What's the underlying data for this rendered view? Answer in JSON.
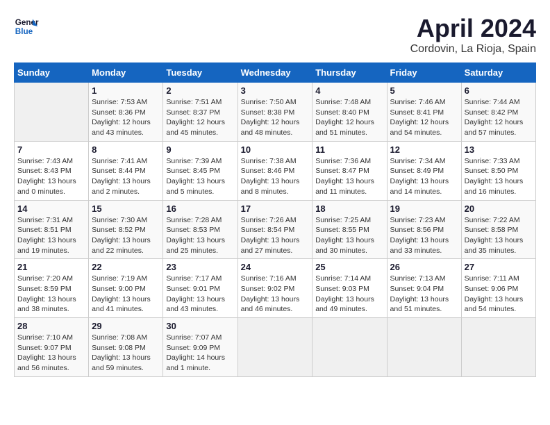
{
  "header": {
    "logo_line1": "General",
    "logo_line2": "Blue",
    "month": "April 2024",
    "location": "Cordovin, La Rioja, Spain"
  },
  "weekdays": [
    "Sunday",
    "Monday",
    "Tuesday",
    "Wednesday",
    "Thursday",
    "Friday",
    "Saturday"
  ],
  "weeks": [
    [
      {
        "day": "",
        "info": ""
      },
      {
        "day": "1",
        "info": "Sunrise: 7:53 AM\nSunset: 8:36 PM\nDaylight: 12 hours\nand 43 minutes."
      },
      {
        "day": "2",
        "info": "Sunrise: 7:51 AM\nSunset: 8:37 PM\nDaylight: 12 hours\nand 45 minutes."
      },
      {
        "day": "3",
        "info": "Sunrise: 7:50 AM\nSunset: 8:38 PM\nDaylight: 12 hours\nand 48 minutes."
      },
      {
        "day": "4",
        "info": "Sunrise: 7:48 AM\nSunset: 8:40 PM\nDaylight: 12 hours\nand 51 minutes."
      },
      {
        "day": "5",
        "info": "Sunrise: 7:46 AM\nSunset: 8:41 PM\nDaylight: 12 hours\nand 54 minutes."
      },
      {
        "day": "6",
        "info": "Sunrise: 7:44 AM\nSunset: 8:42 PM\nDaylight: 12 hours\nand 57 minutes."
      }
    ],
    [
      {
        "day": "7",
        "info": "Sunrise: 7:43 AM\nSunset: 8:43 PM\nDaylight: 13 hours\nand 0 minutes."
      },
      {
        "day": "8",
        "info": "Sunrise: 7:41 AM\nSunset: 8:44 PM\nDaylight: 13 hours\nand 2 minutes."
      },
      {
        "day": "9",
        "info": "Sunrise: 7:39 AM\nSunset: 8:45 PM\nDaylight: 13 hours\nand 5 minutes."
      },
      {
        "day": "10",
        "info": "Sunrise: 7:38 AM\nSunset: 8:46 PM\nDaylight: 13 hours\nand 8 minutes."
      },
      {
        "day": "11",
        "info": "Sunrise: 7:36 AM\nSunset: 8:47 PM\nDaylight: 13 hours\nand 11 minutes."
      },
      {
        "day": "12",
        "info": "Sunrise: 7:34 AM\nSunset: 8:49 PM\nDaylight: 13 hours\nand 14 minutes."
      },
      {
        "day": "13",
        "info": "Sunrise: 7:33 AM\nSunset: 8:50 PM\nDaylight: 13 hours\nand 16 minutes."
      }
    ],
    [
      {
        "day": "14",
        "info": "Sunrise: 7:31 AM\nSunset: 8:51 PM\nDaylight: 13 hours\nand 19 minutes."
      },
      {
        "day": "15",
        "info": "Sunrise: 7:30 AM\nSunset: 8:52 PM\nDaylight: 13 hours\nand 22 minutes."
      },
      {
        "day": "16",
        "info": "Sunrise: 7:28 AM\nSunset: 8:53 PM\nDaylight: 13 hours\nand 25 minutes."
      },
      {
        "day": "17",
        "info": "Sunrise: 7:26 AM\nSunset: 8:54 PM\nDaylight: 13 hours\nand 27 minutes."
      },
      {
        "day": "18",
        "info": "Sunrise: 7:25 AM\nSunset: 8:55 PM\nDaylight: 13 hours\nand 30 minutes."
      },
      {
        "day": "19",
        "info": "Sunrise: 7:23 AM\nSunset: 8:56 PM\nDaylight: 13 hours\nand 33 minutes."
      },
      {
        "day": "20",
        "info": "Sunrise: 7:22 AM\nSunset: 8:58 PM\nDaylight: 13 hours\nand 35 minutes."
      }
    ],
    [
      {
        "day": "21",
        "info": "Sunrise: 7:20 AM\nSunset: 8:59 PM\nDaylight: 13 hours\nand 38 minutes."
      },
      {
        "day": "22",
        "info": "Sunrise: 7:19 AM\nSunset: 9:00 PM\nDaylight: 13 hours\nand 41 minutes."
      },
      {
        "day": "23",
        "info": "Sunrise: 7:17 AM\nSunset: 9:01 PM\nDaylight: 13 hours\nand 43 minutes."
      },
      {
        "day": "24",
        "info": "Sunrise: 7:16 AM\nSunset: 9:02 PM\nDaylight: 13 hours\nand 46 minutes."
      },
      {
        "day": "25",
        "info": "Sunrise: 7:14 AM\nSunset: 9:03 PM\nDaylight: 13 hours\nand 49 minutes."
      },
      {
        "day": "26",
        "info": "Sunrise: 7:13 AM\nSunset: 9:04 PM\nDaylight: 13 hours\nand 51 minutes."
      },
      {
        "day": "27",
        "info": "Sunrise: 7:11 AM\nSunset: 9:06 PM\nDaylight: 13 hours\nand 54 minutes."
      }
    ],
    [
      {
        "day": "28",
        "info": "Sunrise: 7:10 AM\nSunset: 9:07 PM\nDaylight: 13 hours\nand 56 minutes."
      },
      {
        "day": "29",
        "info": "Sunrise: 7:08 AM\nSunset: 9:08 PM\nDaylight: 13 hours\nand 59 minutes."
      },
      {
        "day": "30",
        "info": "Sunrise: 7:07 AM\nSunset: 9:09 PM\nDaylight: 14 hours\nand 1 minute."
      },
      {
        "day": "",
        "info": ""
      },
      {
        "day": "",
        "info": ""
      },
      {
        "day": "",
        "info": ""
      },
      {
        "day": "",
        "info": ""
      }
    ]
  ]
}
